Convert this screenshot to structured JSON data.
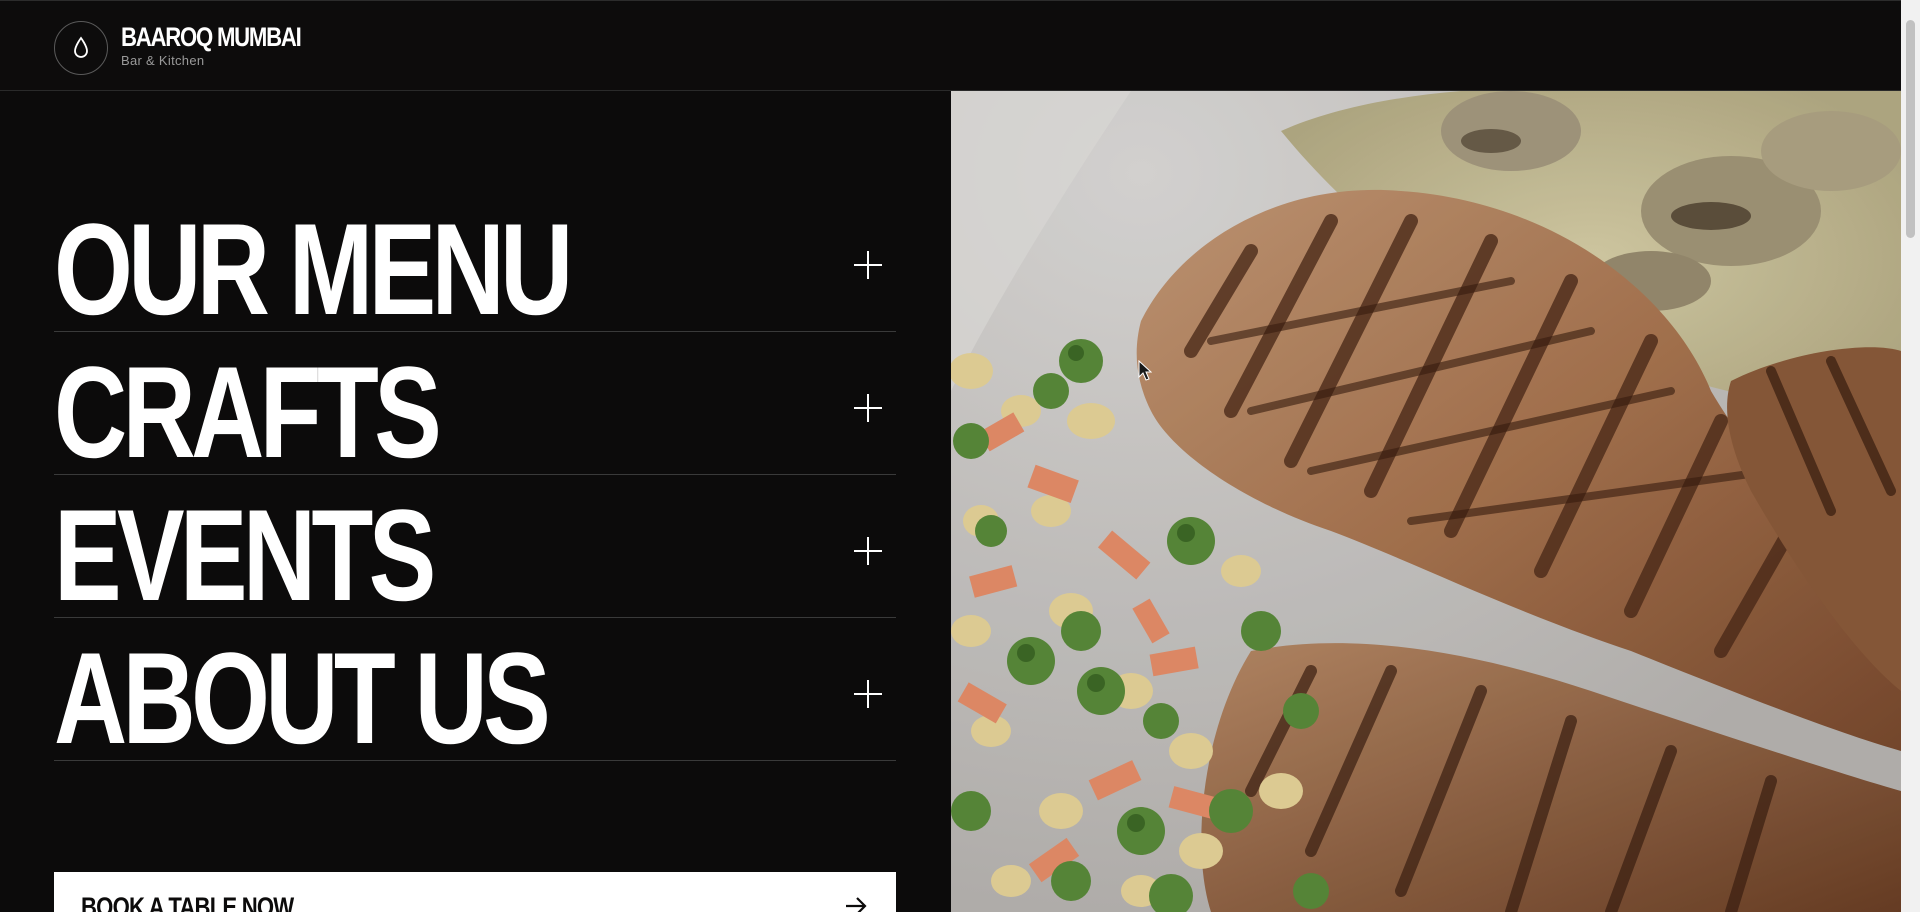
{
  "header": {
    "brand_name": "BAAROQ MUMBAI",
    "brand_subtitle": "Bar & Kitchen",
    "logo_icon": "drop-icon"
  },
  "nav": {
    "items": [
      {
        "label": "OUR MENU",
        "icon": "plus-icon"
      },
      {
        "label": "CRAFTS",
        "icon": "plus-icon"
      },
      {
        "label": "EVENTS",
        "icon": "plus-icon"
      },
      {
        "label": "ABOUT US",
        "icon": "plus-icon"
      }
    ]
  },
  "cta": {
    "label": "BOOK A TABLE NOW",
    "icon": "arrow-right-icon"
  },
  "hero": {
    "image": "grilled-chicken-with-vegetables"
  },
  "colors": {
    "background": "#0c0b0b",
    "text": "#ffffff",
    "divider": "#3a3a3a",
    "cta_background": "#ffffff",
    "cta_text": "#0c0b0b"
  }
}
